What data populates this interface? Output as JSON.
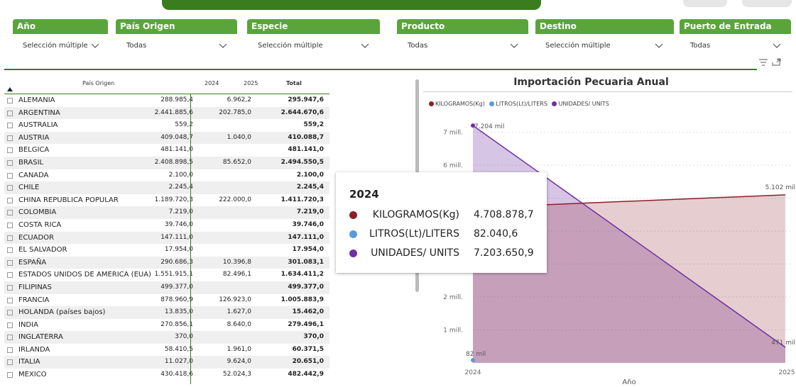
{
  "filters": [
    {
      "label": "Año",
      "value": ""
    },
    {
      "label": "País Origen",
      "value": "Todas"
    },
    {
      "label": "Especie",
      "value": "Selección múltiple"
    },
    {
      "label": "Producto",
      "value": "Todas"
    },
    {
      "label": "Destino",
      "value": "Selección múltiple"
    },
    {
      "label": "Puerto de Entrada",
      "value": "Todas"
    }
  ],
  "year_filter_value": "Selección múltiple",
  "table": {
    "headers": {
      "country": "País Origen",
      "y2024": "2024",
      "y2025": "2025",
      "total": "Total"
    },
    "rows": [
      {
        "country": "ALEMANIA",
        "y2024": "288.985,4",
        "y2025": "6.962,2",
        "total": "295.947,6"
      },
      {
        "country": "ARGENTINA",
        "y2024": "2.441.885,6",
        "y2025": "202.785,0",
        "total": "2.644.670,6"
      },
      {
        "country": "AUSTRALIA",
        "y2024": "559,2",
        "y2025": "",
        "total": "559,2"
      },
      {
        "country": "AUSTRIA",
        "y2024": "409.048,7",
        "y2025": "1.040,0",
        "total": "410.088,7"
      },
      {
        "country": "BELGICA",
        "y2024": "481.141,0",
        "y2025": "",
        "total": "481.141,0"
      },
      {
        "country": "BRASIL",
        "y2024": "2.408.898,5",
        "y2025": "85.652,0",
        "total": "2.494.550,5"
      },
      {
        "country": "CANADA",
        "y2024": "2.100,0",
        "y2025": "",
        "total": "2.100,0"
      },
      {
        "country": "CHILE",
        "y2024": "2.245,4",
        "y2025": "",
        "total": "2.245,4"
      },
      {
        "country": "CHINA REPUBLICA POPULAR",
        "y2024": "1.189.720,3",
        "y2025": "222.000,0",
        "total": "1.411.720,3"
      },
      {
        "country": "COLOMBIA",
        "y2024": "7.219,0",
        "y2025": "",
        "total": "7.219,0"
      },
      {
        "country": "COSTA RICA",
        "y2024": "39.746,0",
        "y2025": "",
        "total": "39.746,0"
      },
      {
        "country": "ECUADOR",
        "y2024": "147.111,0",
        "y2025": "",
        "total": "147.111,0"
      },
      {
        "country": "EL SALVADOR",
        "y2024": "17.954,0",
        "y2025": "",
        "total": "17.954,0"
      },
      {
        "country": "ESPAÑA",
        "y2024": "290.686,3",
        "y2025": "10.396,8",
        "total": "301.083,1"
      },
      {
        "country": "ESTADOS UNIDOS DE AMERICA (EUA)",
        "y2024": "1.551.915,1",
        "y2025": "82.496,1",
        "total": "1.634.411,2"
      },
      {
        "country": "FILIPINAS",
        "y2024": "499.377,0",
        "y2025": "",
        "total": "499.377,0"
      },
      {
        "country": "FRANCIA",
        "y2024": "878.960,9",
        "y2025": "126.923,0",
        "total": "1.005.883,9"
      },
      {
        "country": "HOLANDA (países bajos)",
        "y2024": "13.835,0",
        "y2025": "1.627,0",
        "total": "15.462,0"
      },
      {
        "country": "INDIA",
        "y2024": "270.856,1",
        "y2025": "8.640,0",
        "total": "279.496,1"
      },
      {
        "country": "INGLATERRA",
        "y2024": "370,0",
        "y2025": "",
        "total": "370,0"
      },
      {
        "country": "IRLANDA",
        "y2024": "58.410,5",
        "y2025": "1.961,0",
        "total": "60.371,5"
      },
      {
        "country": "ITALIA",
        "y2024": "11.027,0",
        "y2025": "9.624,0",
        "total": "20.651,0"
      },
      {
        "country": "MEXICO",
        "y2024": "430.418,6",
        "y2025": "52.024,3",
        "total": "482.442,9"
      }
    ]
  },
  "chart": {
    "title": "Importación Pecuaria Anual",
    "xlabel": "Año",
    "legend": [
      {
        "name": "KILOGRAMOS(Kg)",
        "color": "#8b1f2a"
      },
      {
        "name": "LITROS(Lt)/LITERS",
        "color": "#5b9bd5"
      },
      {
        "name": "UNIDADES/ UNITS",
        "color": "#7030a0"
      }
    ],
    "y_ticks": [
      "7 mill.",
      "6 mill.",
      "2 mill.",
      "1 mill."
    ],
    "x_ticks": [
      "2024",
      "2025"
    ],
    "data_labels": {
      "units_2024": "7.204 mil",
      "kg_2025": "5.102 mil",
      "units_2025": "471 mil",
      "liters_2024": "82 mil"
    }
  },
  "chart_data": {
    "type": "area",
    "title": "Importación Pecuaria Anual",
    "xlabel": "Año",
    "ylabel": "",
    "x": [
      "2024",
      "2025"
    ],
    "ylim": [
      0,
      7400000
    ],
    "series": [
      {
        "name": "KILOGRAMOS(Kg)",
        "values": [
          4708878.7,
          5102000
        ]
      },
      {
        "name": "LITROS(Lt)/LITERS",
        "values": [
          82040.6,
          null
        ]
      },
      {
        "name": "UNIDADES/ UNITS",
        "values": [
          7203650.9,
          471000
        ]
      }
    ]
  },
  "tooltip": {
    "title": "2024",
    "rows": [
      {
        "label": "KILOGRAMOS(Kg)",
        "value": "4.708.878,7",
        "color": "#8b1f2a"
      },
      {
        "label": "LITROS(Lt)/LITERS",
        "value": "82.040,6",
        "color": "#5b9bd5"
      },
      {
        "label": "UNIDADES/ UNITS",
        "value": "7.203.650,9",
        "color": "#7030a0"
      }
    ]
  }
}
